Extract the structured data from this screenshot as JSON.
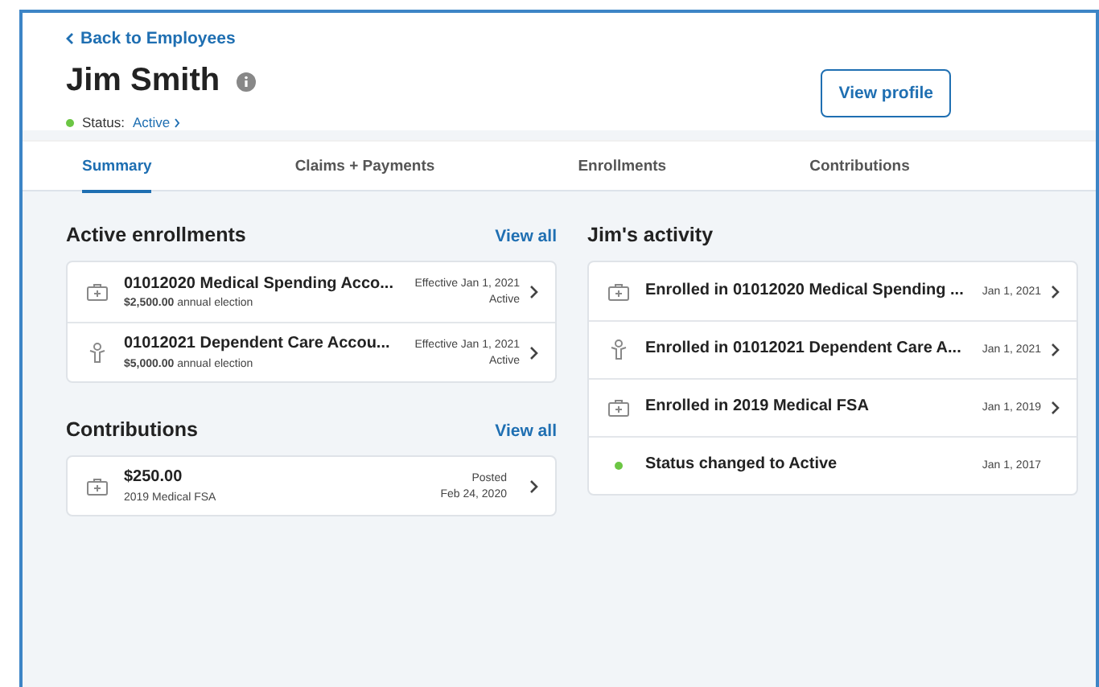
{
  "back_link": "Back to Employees",
  "employee": {
    "name": "Jim Smith",
    "status_label": "Status:",
    "status": "Active"
  },
  "view_profile_button": "View profile",
  "tabs": [
    {
      "label": "Summary",
      "selected": true
    },
    {
      "label": "Claims + Payments",
      "selected": false
    },
    {
      "label": "Enrollments",
      "selected": false
    },
    {
      "label": "Contributions",
      "selected": false
    }
  ],
  "active_enrollments": {
    "title": "Active enrollments",
    "view_all": "View all",
    "items": [
      {
        "kind": "medical",
        "name": "01012020 Medical Spending Acco...",
        "amount": "$2,500.00",
        "note": "annual election",
        "effective": "Effective Jan 1, 2021",
        "status": "Active"
      },
      {
        "kind": "dependent",
        "name": "01012021 Dependent Care Accou...",
        "amount": "$5,000.00",
        "note": "annual election",
        "effective": "Effective Jan 1, 2021",
        "status": "Active"
      }
    ]
  },
  "contributions": {
    "title": "Contributions",
    "view_all": "View all",
    "items": [
      {
        "kind": "medical",
        "amount": "$250.00",
        "plan": "2019 Medical FSA",
        "state": "Posted",
        "date": "Feb 24, 2020"
      }
    ]
  },
  "activity": {
    "title": "Jim's activity",
    "items": [
      {
        "kind": "medical",
        "text": "Enrolled in 01012020 Medical Spending ...",
        "date": "Jan 1, 2021"
      },
      {
        "kind": "dependent",
        "text": "Enrolled in 01012021 Dependent Care A...",
        "date": "Jan 1, 2021"
      },
      {
        "kind": "medical",
        "text": "Enrolled in 2019 Medical FSA",
        "date": "Jan 1, 2019"
      },
      {
        "kind": "status",
        "text": "Status changed to Active",
        "date": "Jan 1, 2017"
      }
    ]
  }
}
